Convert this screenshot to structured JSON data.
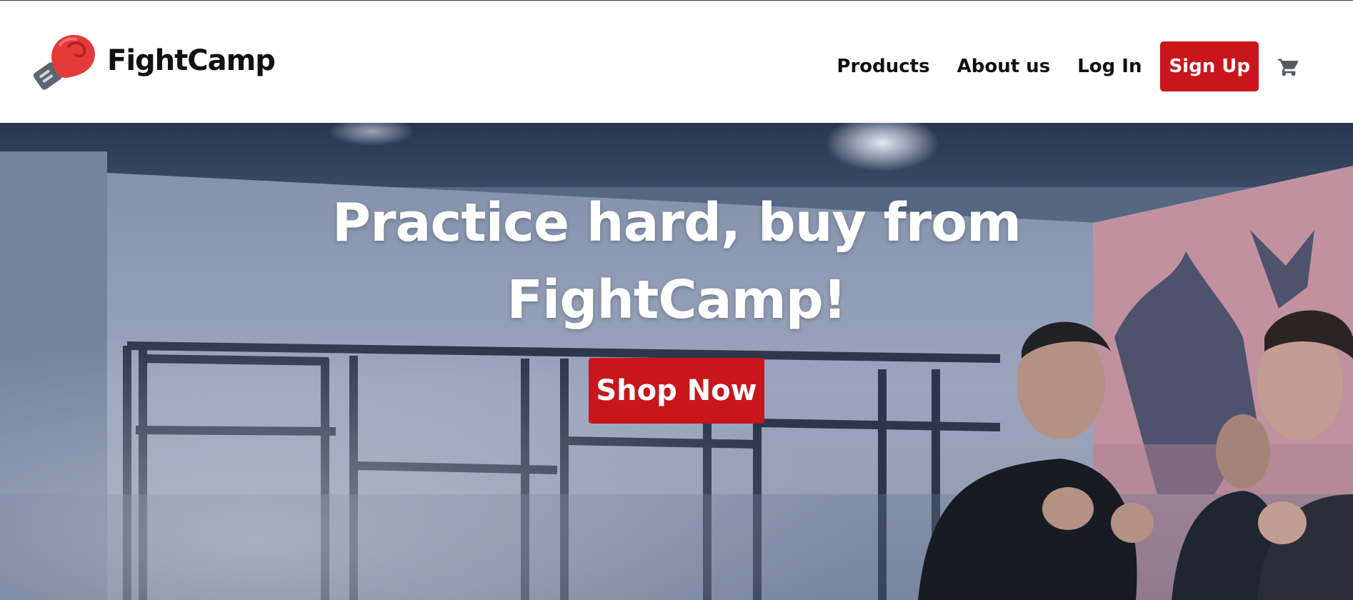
{
  "header": {
    "brand": "FightCamp",
    "logo_icon": "boxing-glove-icon",
    "nav": [
      {
        "label": "Products"
      },
      {
        "label": "About us"
      },
      {
        "label": "Log In"
      }
    ],
    "signup_label": "Sign Up",
    "cart_icon": "shopping-cart-icon"
  },
  "hero": {
    "title": "Practice hard, buy from FightCamp!",
    "cta_label": "Shop Now",
    "background": "gym-training-photo"
  },
  "colors": {
    "accent": "#c8161c",
    "text_dark": "#111111",
    "hero_text": "#ffffff"
  }
}
